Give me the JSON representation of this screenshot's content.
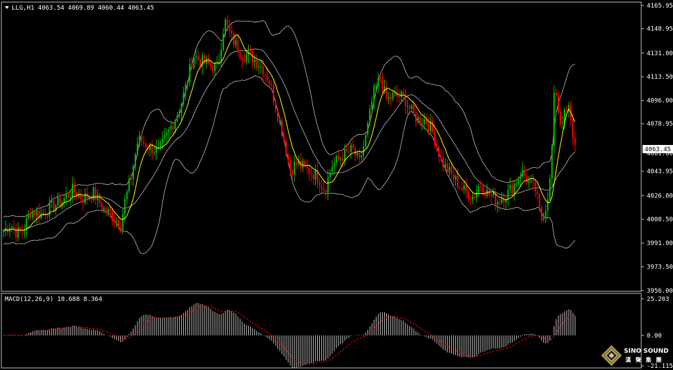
{
  "window": {
    "symbol_header": "LLG,H1  4063.54 4069.89 4060.44 4063.45",
    "current_price": "4063.45"
  },
  "price_axis": {
    "labels": [
      "4165.95",
      "4148.95",
      "4131.00",
      "4113.50",
      "4096.00",
      "4078.95",
      "4043.95",
      "4026.00",
      "4008.50",
      "3991.00",
      "3973.50",
      "3956.00"
    ],
    "values": [
      4165.95,
      4148.95,
      4131.0,
      4113.5,
      4096.0,
      4078.95,
      4043.95,
      4026.0,
      4008.5,
      3991.0,
      3973.5,
      3956.0
    ],
    "hidden_label": "4061.00"
  },
  "macd": {
    "header": "MACD(12,26,9) 10.688 8.364",
    "labels": [
      "25.203",
      "0.00",
      "-21.115"
    ],
    "values": [
      25.203,
      0,
      -21.115
    ]
  },
  "colors": {
    "background": "#000000",
    "bull": "#00c000",
    "bear": "#ff0000",
    "bands": "#c0c0c0",
    "ma": "#ffff00",
    "signal": "#ff0000",
    "hist": "#c0c0c0",
    "frame": "#c0c0c0",
    "price_tag": "#ffffff"
  },
  "icons": {
    "menu": "triangle-down-icon",
    "logo": "sino-sound-diamond-icon"
  },
  "logo": {
    "name": "SINO SOUND",
    "subtitle": "漢 聲 集 團"
  },
  "chart_data": {
    "type": "candlestick",
    "price_anchors": [
      [
        0,
        4000
      ],
      [
        10,
        4005
      ],
      [
        20,
        3998
      ],
      [
        30,
        4002
      ],
      [
        40,
        4015
      ],
      [
        55,
        4012
      ],
      [
        70,
        4018
      ],
      [
        85,
        4022
      ],
      [
        100,
        4030
      ],
      [
        115,
        4024
      ],
      [
        130,
        4028
      ],
      [
        145,
        4016
      ],
      [
        160,
        4010
      ],
      [
        170,
        4005
      ],
      [
        175,
        4020
      ],
      [
        185,
        4040
      ],
      [
        195,
        4068
      ],
      [
        210,
        4062
      ],
      [
        225,
        4058
      ],
      [
        240,
        4074
      ],
      [
        255,
        4090
      ],
      [
        265,
        4108
      ],
      [
        275,
        4130
      ],
      [
        285,
        4125
      ],
      [
        300,
        4122
      ],
      [
        310,
        4120
      ],
      [
        320,
        4155
      ],
      [
        330,
        4142
      ],
      [
        345,
        4130
      ],
      [
        360,
        4128
      ],
      [
        375,
        4120
      ],
      [
        385,
        4110
      ],
      [
        395,
        4090
      ],
      [
        405,
        4070
      ],
      [
        415,
        4045
      ],
      [
        425,
        4050
      ],
      [
        440,
        4045
      ],
      [
        455,
        4040
      ],
      [
        465,
        4030
      ],
      [
        475,
        4048
      ],
      [
        490,
        4055
      ],
      [
        505,
        4060
      ],
      [
        515,
        4050
      ],
      [
        525,
        4070
      ],
      [
        535,
        4100
      ],
      [
        545,
        4112
      ],
      [
        555,
        4096
      ],
      [
        565,
        4100
      ],
      [
        580,
        4098
      ],
      [
        590,
        4088
      ],
      [
        600,
        4082
      ],
      [
        610,
        4082
      ],
      [
        620,
        4075
      ],
      [
        635,
        4050
      ],
      [
        650,
        4040
      ],
      [
        665,
        4030
      ],
      [
        680,
        4025
      ],
      [
        690,
        4035
      ],
      [
        700,
        4028
      ],
      [
        715,
        4022
      ],
      [
        730,
        4028
      ],
      [
        740,
        4035
      ],
      [
        750,
        4044
      ],
      [
        760,
        4036
      ],
      [
        770,
        4030
      ],
      [
        778,
        4008
      ],
      [
        785,
        4018
      ],
      [
        792,
        4040
      ],
      [
        798,
        4110
      ],
      [
        805,
        4080
      ],
      [
        812,
        4085
      ],
      [
        818,
        4090
      ],
      [
        825,
        4068
      ],
      [
        830,
        4063.45
      ]
    ],
    "ylim": [
      3956,
      4168
    ],
    "macd_ylim": [
      -21.115,
      25.203
    ],
    "macd_value": 10.688,
    "signal_value": 8.364
  }
}
